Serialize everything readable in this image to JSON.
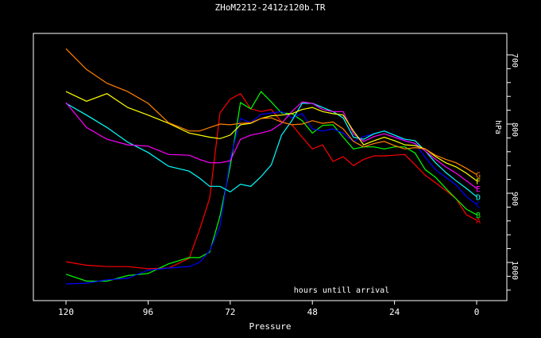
{
  "chart_data": {
    "type": "line",
    "title": "ZHoM2212-2412z120b.TR",
    "xlabel": "Pressure",
    "ylabel": "hPa",
    "annotation": "hours untill arrival",
    "xlim": [
      120,
      0
    ],
    "ylim": [
      1000,
      700
    ],
    "x_ticks": [
      "120",
      "96",
      "72",
      "48",
      "24",
      "0"
    ],
    "y_ticks": [
      "700",
      "800",
      "900",
      "1000"
    ],
    "grid": false,
    "x": [
      120,
      114,
      108,
      102,
      96,
      90,
      84,
      81,
      78,
      75,
      72,
      69,
      66,
      63,
      60,
      57,
      54,
      51,
      48,
      45,
      42,
      39,
      36,
      33,
      30,
      27,
      24,
      21,
      18,
      15,
      12,
      9,
      6,
      3,
      0
    ],
    "series": [
      {
        "name": "A",
        "color": "#ff0000",
        "values": [
          999,
          1004,
          1006,
          1006,
          1009,
          1008,
          994,
          953,
          907,
          784,
          764,
          756,
          778,
          782,
          779,
          797,
          801,
          819,
          836,
          830,
          854,
          847,
          860,
          851,
          846,
          846,
          845,
          844,
          859,
          874,
          885,
          896,
          908,
          931,
          939
        ]
      },
      {
        "name": "B",
        "color": "#00ff00",
        "values": [
          1017,
          1027,
          1027,
          1019,
          1016,
          1002,
          993,
          993,
          985,
          933,
          861,
          769,
          778,
          753,
          768,
          784,
          785,
          795,
          813,
          802,
          801,
          819,
          836,
          833,
          833,
          836,
          833,
          833,
          842,
          866,
          877,
          893,
          908,
          923,
          931
        ]
      },
      {
        "name": "C",
        "color": "#0000ff",
        "values": [
          1031,
          1030,
          1025,
          1023,
          1011,
          1008,
          1006,
          1000,
          983,
          948,
          851,
          792,
          798,
          786,
          784,
          782,
          791,
          785,
          807,
          810,
          807,
          813,
          825,
          818,
          814,
          810,
          816,
          824,
          828,
          848,
          866,
          877,
          888,
          905,
          916
        ]
      },
      {
        "name": "D",
        "color": "#00ffff",
        "values": [
          770,
          787,
          805,
          826,
          841,
          861,
          868,
          878,
          890,
          890,
          898,
          887,
          890,
          876,
          859,
          816,
          795,
          770,
          770,
          776,
          782,
          791,
          819,
          822,
          814,
          810,
          816,
          822,
          824,
          839,
          856,
          870,
          882,
          893,
          905
        ]
      },
      {
        "name": "E",
        "color": "#ff00ff",
        "values": [
          769,
          805,
          822,
          830,
          832,
          844,
          845,
          851,
          856,
          856,
          853,
          822,
          816,
          813,
          809,
          799,
          782,
          768,
          770,
          779,
          782,
          782,
          814,
          825,
          818,
          814,
          819,
          824,
          828,
          839,
          851,
          862,
          871,
          882,
          893
        ]
      },
      {
        "name": "F",
        "color": "#ffff00",
        "values": [
          753,
          767,
          756,
          776,
          787,
          799,
          813,
          816,
          819,
          821,
          816,
          801,
          799,
          792,
          788,
          787,
          785,
          779,
          776,
          782,
          785,
          787,
          810,
          830,
          824,
          819,
          824,
          830,
          831,
          836,
          847,
          856,
          862,
          871,
          882
        ]
      },
      {
        "name": "G",
        "color": "#ff8000",
        "values": [
          691,
          721,
          741,
          753,
          770,
          798,
          810,
          810,
          805,
          800,
          801,
          799,
          798,
          792,
          791,
          797,
          801,
          800,
          795,
          799,
          797,
          807,
          825,
          833,
          828,
          825,
          831,
          836,
          834,
          836,
          845,
          851,
          856,
          864,
          873
        ]
      }
    ]
  }
}
